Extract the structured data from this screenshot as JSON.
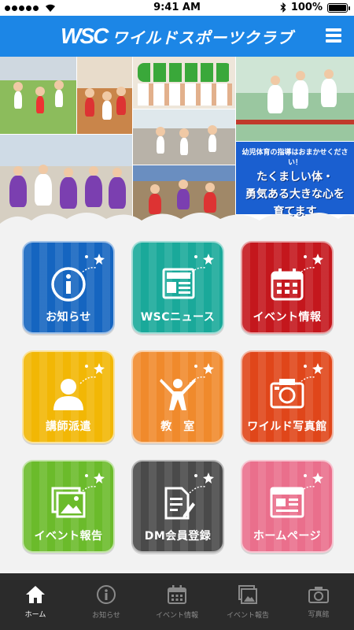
{
  "status_bar": {
    "time": "9:41 AM",
    "battery": "100%"
  },
  "header": {
    "logo_mark": "WSC",
    "logo_name": "ワイルドスポーツクラブ"
  },
  "hero": {
    "promo_small": "幼児体育の指導はおまかせください！",
    "promo_big_1": "たくましい体・",
    "promo_big_2": "勇気ある大きな心を",
    "promo_big_3": "育てます"
  },
  "tiles": [
    {
      "label": "お知らせ",
      "color": "#1565c0"
    },
    {
      "label": "WSCニュース",
      "color": "#1aa99a"
    },
    {
      "label": "イベント情報",
      "color": "#c4171d"
    },
    {
      "label": "講師派遣",
      "color": "#f2b705"
    },
    {
      "label": "教　室",
      "color": "#f08a2c"
    },
    {
      "label": "ワイルド写真館",
      "color": "#e0461a"
    },
    {
      "label": "イベント報告",
      "color": "#6bbb2b"
    },
    {
      "label": "DM会員登録",
      "color": "#4a4a4a"
    },
    {
      "label": "ホームページ",
      "color": "#ea6f8c"
    }
  ],
  "tabbar": {
    "items": [
      {
        "label": "ホーム",
        "icon": "home-icon"
      },
      {
        "label": "お知らせ",
        "icon": "info-icon"
      },
      {
        "label": "イベント情報",
        "icon": "calendar-icon"
      },
      {
        "label": "イベント報告",
        "icon": "picture-icon"
      },
      {
        "label": "写真館",
        "icon": "camera-icon"
      }
    ],
    "active_index": 0
  }
}
